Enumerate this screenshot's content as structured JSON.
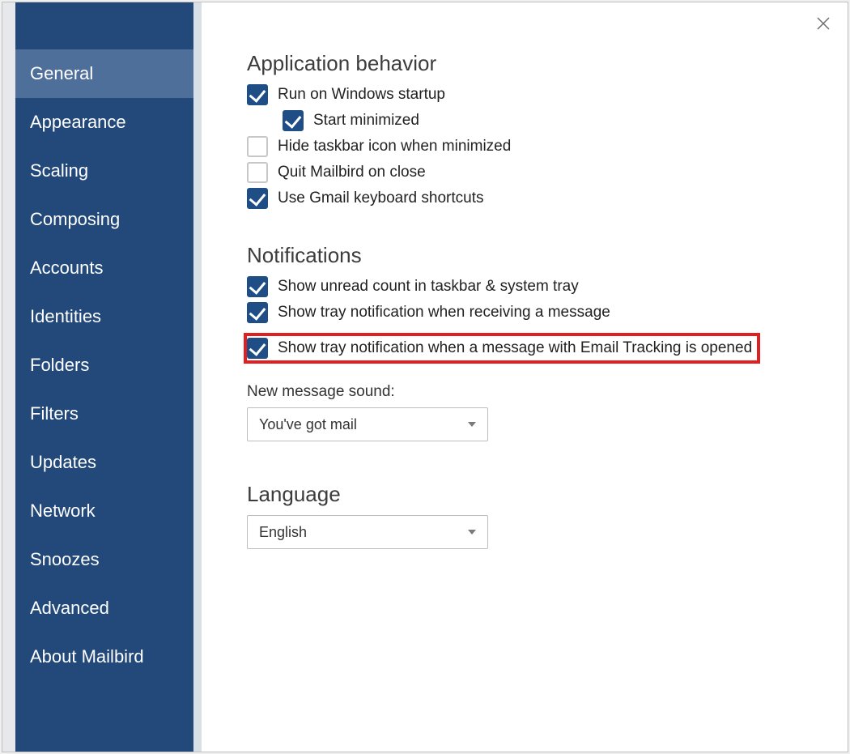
{
  "sidebar": {
    "items": [
      {
        "label": "General",
        "active": true
      },
      {
        "label": "Appearance",
        "active": false
      },
      {
        "label": "Scaling",
        "active": false
      },
      {
        "label": "Composing",
        "active": false
      },
      {
        "label": "Accounts",
        "active": false
      },
      {
        "label": "Identities",
        "active": false
      },
      {
        "label": "Folders",
        "active": false
      },
      {
        "label": "Filters",
        "active": false
      },
      {
        "label": "Updates",
        "active": false
      },
      {
        "label": "Network",
        "active": false
      },
      {
        "label": "Snoozes",
        "active": false
      },
      {
        "label": "Advanced",
        "active": false
      },
      {
        "label": "About Mailbird",
        "active": false
      }
    ]
  },
  "sections": {
    "app_behavior": {
      "title": "Application behavior",
      "options": {
        "run_on_startup": {
          "label": "Run on Windows startup",
          "checked": true
        },
        "start_minimized": {
          "label": "Start minimized",
          "checked": true
        },
        "hide_taskbar_icon": {
          "label": "Hide taskbar icon when minimized",
          "checked": false
        },
        "quit_on_close": {
          "label": "Quit Mailbird on close",
          "checked": false
        },
        "gmail_shortcuts": {
          "label": "Use Gmail keyboard shortcuts",
          "checked": true
        }
      }
    },
    "notifications": {
      "title": "Notifications",
      "options": {
        "show_unread_count": {
          "label": "Show unread count in taskbar & system tray",
          "checked": true
        },
        "tray_on_receive": {
          "label": "Show tray notification when receiving a message",
          "checked": true
        },
        "tray_on_tracking_open": {
          "label": "Show tray notification when a message with Email Tracking is opened",
          "checked": true
        }
      },
      "sound_label": "New message sound:",
      "sound_value": "You've got mail"
    },
    "language": {
      "title": "Language",
      "value": "English"
    }
  }
}
